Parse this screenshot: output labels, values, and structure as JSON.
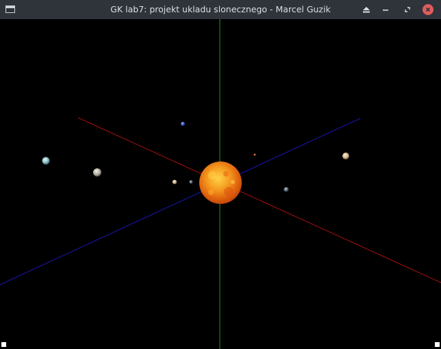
{
  "window": {
    "title": "GK lab7: projekt ukladu slonecznego - Marcel Guzik",
    "icon": "app-window-icon",
    "controls": [
      {
        "name": "shade-button",
        "icon": "eject-icon"
      },
      {
        "name": "minimize-button",
        "icon": "minimize-icon"
      },
      {
        "name": "restore-button",
        "icon": "restore-icon"
      },
      {
        "name": "close-button",
        "icon": "close-icon"
      }
    ]
  },
  "scene": {
    "background": "#000000",
    "axes": {
      "x_color": "#b01010",
      "y_color": "#18a018",
      "z_color": "#1818b8"
    },
    "sun_color": "#f08a1c",
    "body_count": 9
  }
}
